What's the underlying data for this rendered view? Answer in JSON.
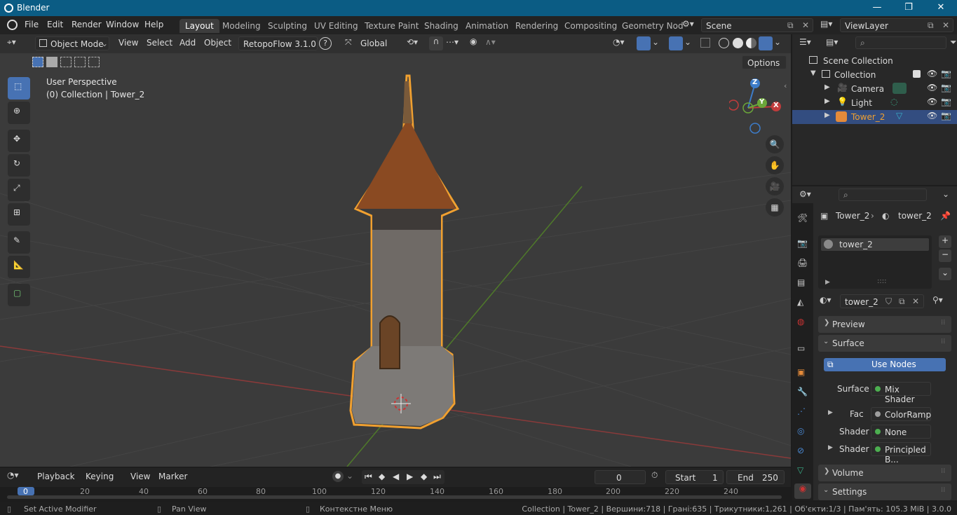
{
  "app": {
    "title": "Blender"
  },
  "window_controls": {
    "minimize": "—",
    "maximize": "❐",
    "close": "✕"
  },
  "menu": [
    "File",
    "Edit",
    "Render",
    "Window",
    "Help"
  ],
  "workspaces": [
    "Layout",
    "Modeling",
    "Sculpting",
    "UV Editing",
    "Texture Paint",
    "Shading",
    "Animation",
    "Rendering",
    "Compositing",
    "Geometry Nod"
  ],
  "scene": {
    "name": "Scene",
    "view_layer": "ViewLayer"
  },
  "viewport_header": {
    "mode": "Object Mode",
    "menus": [
      "View",
      "Select",
      "Add",
      "Object"
    ],
    "addon": "RetopoFlow 3.1.0",
    "help": "?",
    "orientation": "Global",
    "options": "Options"
  },
  "viewport": {
    "perspective": "User Perspective",
    "collection_info": "(0) Collection | Tower_2",
    "gizmo": {
      "z": "Z",
      "y": "Y",
      "x": "X"
    }
  },
  "outliner": {
    "root": "Scene Collection",
    "items": [
      {
        "label": "Collection",
        "depth": 1
      },
      {
        "label": "Camera",
        "depth": 2
      },
      {
        "label": "Light",
        "depth": 2
      },
      {
        "label": "Tower_2",
        "depth": 2,
        "selected": true
      }
    ]
  },
  "properties": {
    "breadcrumb_object": "Tower_2",
    "breadcrumb_material": "tower_2",
    "material_slot": "tower_2",
    "material_name": "tower_2",
    "panels": {
      "preview": "Preview",
      "surface": "Surface",
      "volume": "Volume",
      "settings": "Settings"
    },
    "use_nodes": "Use Nodes",
    "rows": [
      {
        "label": "Surface",
        "value": "Mix Shader",
        "color": "#4caf50",
        "expand": false
      },
      {
        "label": "Fac",
        "value": "ColorRamp",
        "color": "#9e9e9e",
        "expand": true
      },
      {
        "label": "Shader",
        "value": "None",
        "color": "#4caf50",
        "expand": false
      },
      {
        "label": "Shader",
        "value": "Principled B...",
        "color": "#4caf50",
        "expand": true
      }
    ]
  },
  "timeline": {
    "menus": [
      "Playback",
      "Keying",
      "View",
      "Marker"
    ],
    "current_frame": "0",
    "start_label": "Start",
    "start": "1",
    "end_label": "End",
    "end": "250",
    "ruler": [
      "0",
      "20",
      "40",
      "60",
      "80",
      "100",
      "120",
      "140",
      "160",
      "180",
      "200",
      "220",
      "240"
    ]
  },
  "statusbar": {
    "left": "Set Active Modifier",
    "middle": "Pan View",
    "context": "Контекстне Меню",
    "stats": "Collection | Tower_2 | Вершини:718 | Грані:635 | Трикутники:1,261 | Об'єкти:1/3 | Пам'ять: 105.3 MiB | 3.0.0"
  },
  "colors": {
    "accent": "#4772b3",
    "titlebar": "#0b5c84",
    "selection": "#f0a030"
  }
}
